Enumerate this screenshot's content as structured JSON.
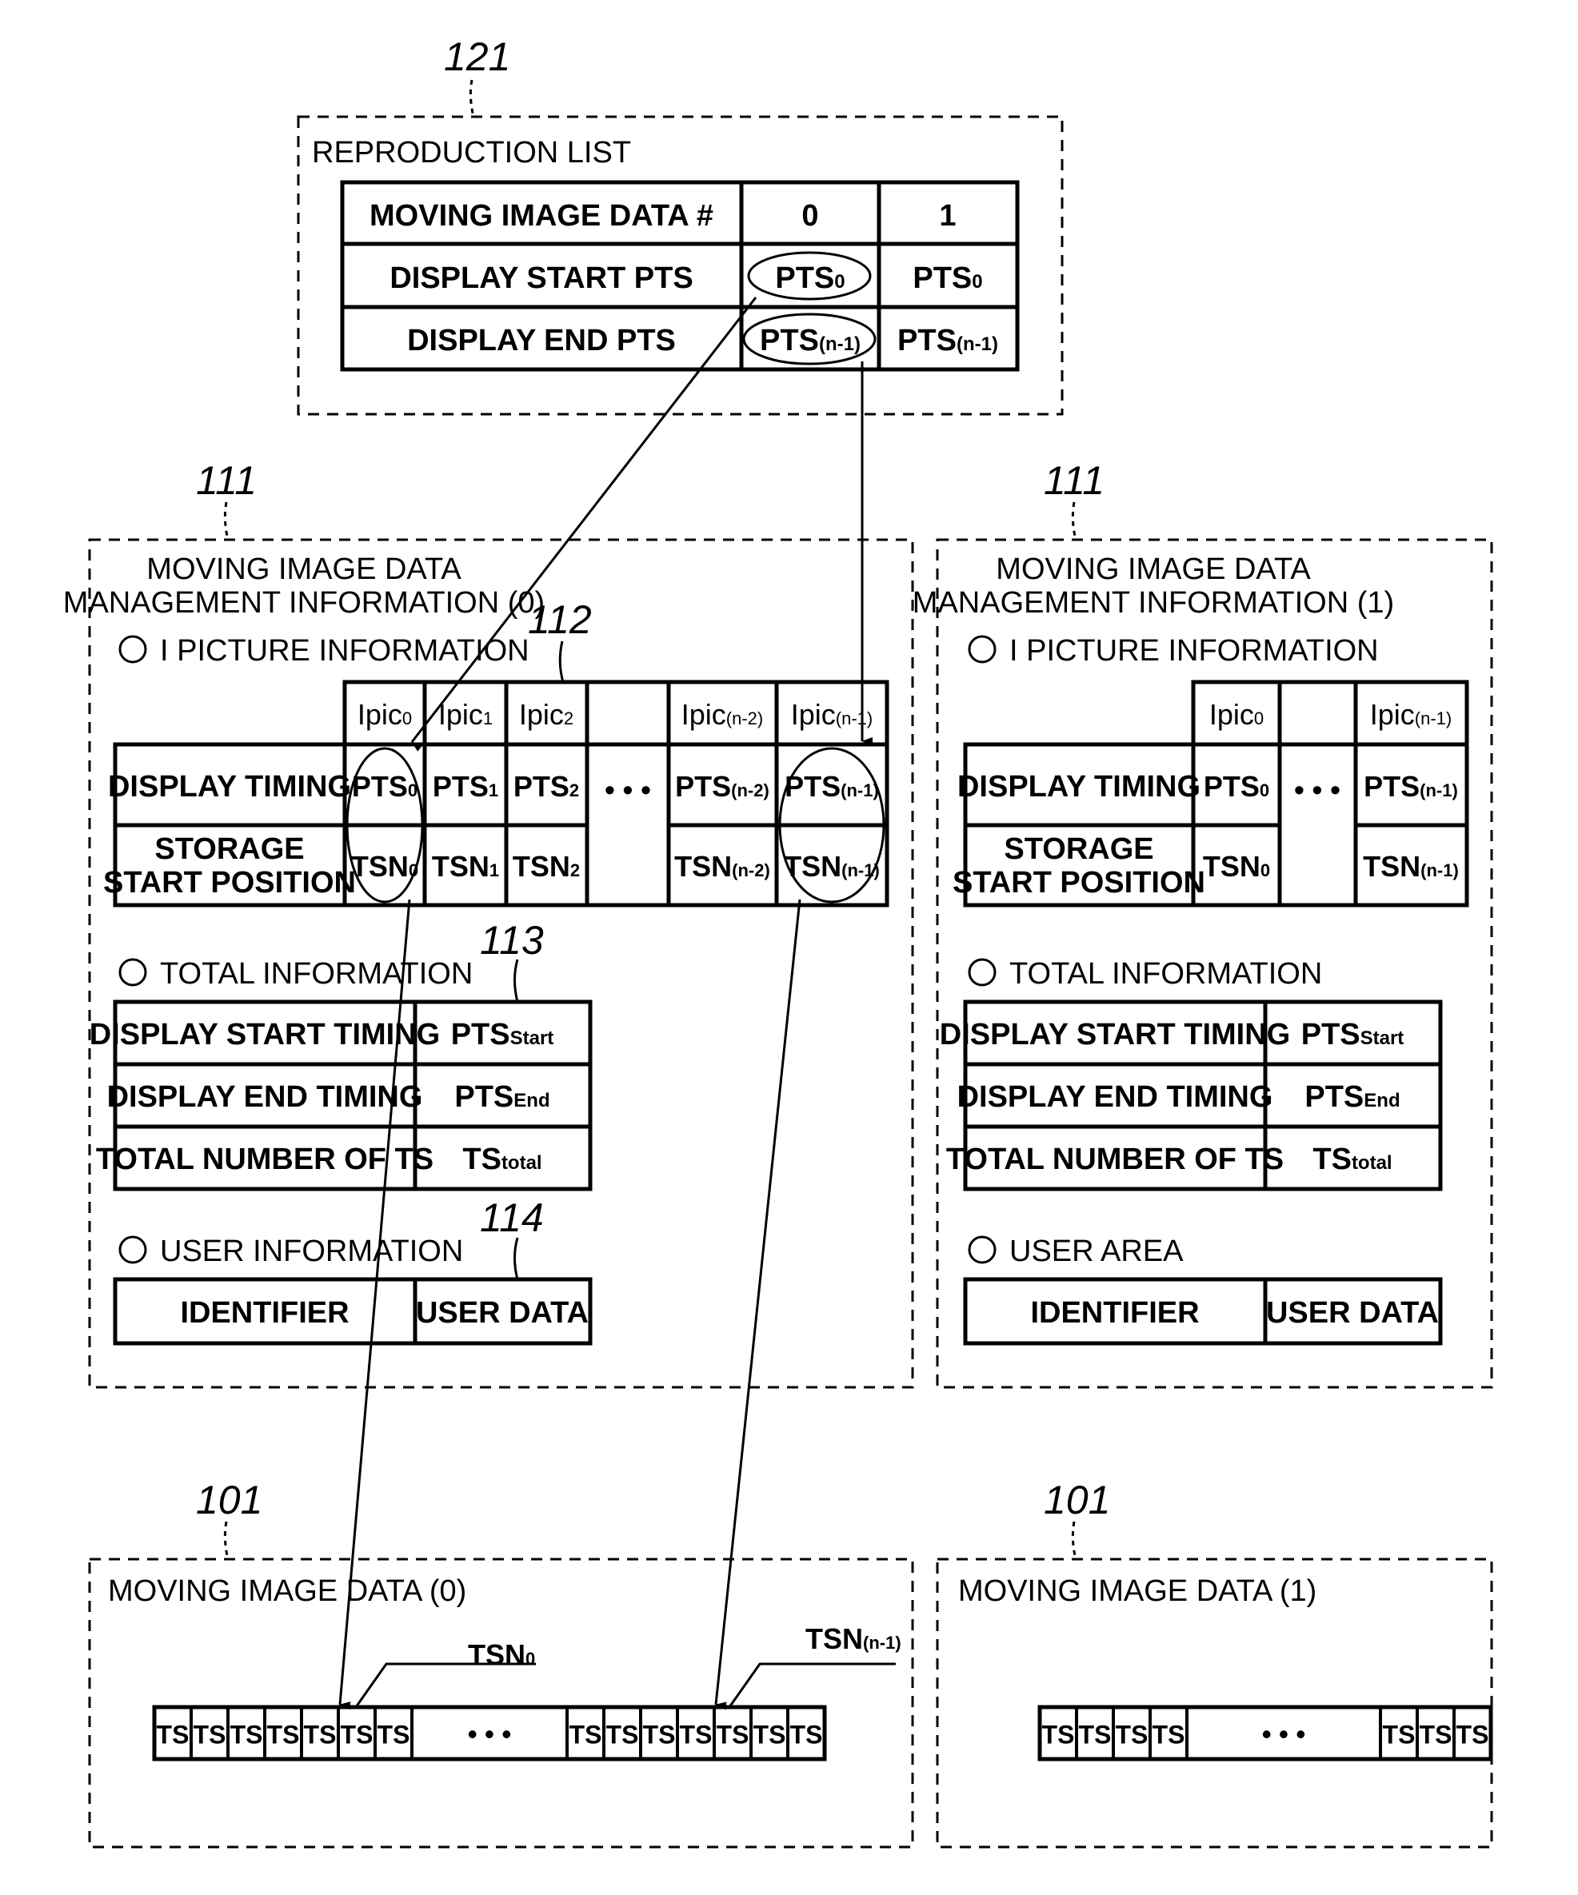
{
  "refs": {
    "reproduction_list": "121",
    "management_info": "111",
    "i_picture_table": "112",
    "total_info_table": "113",
    "user_info_table": "114",
    "moving_image_data": "101"
  },
  "reproduction_list": {
    "title": "REPRODUCTION LIST",
    "rows": [
      {
        "label": "MOVING IMAGE DATA #",
        "cells": [
          {
            "main": "0",
            "sub": ""
          },
          {
            "main": "1",
            "sub": ""
          }
        ]
      },
      {
        "label": "DISPLAY START PTS",
        "cells": [
          {
            "main": "PTS",
            "sub": "0"
          },
          {
            "main": "PTS",
            "sub": "0"
          }
        ]
      },
      {
        "label": "DISPLAY END PTS",
        "cells": [
          {
            "main": "PTS",
            "sub": "(n-1)"
          },
          {
            "main": "PTS",
            "sub": "(n-1)"
          }
        ]
      }
    ]
  },
  "management": [
    {
      "title_line1": "MOVING IMAGE DATA",
      "title_line2": "MANAGEMENT INFORMATION (0)",
      "i_picture": {
        "heading": "I PICTURE INFORMATION",
        "row_labels": [
          "DISPLAY TIMING",
          "STORAGE",
          "START POSITION"
        ],
        "columns": [
          {
            "ipic": "Ipic",
            "ipic_sub": "0",
            "pts": "PTS",
            "pts_sub": "0",
            "tsn": "TSN",
            "tsn_sub": "0"
          },
          {
            "ipic": "Ipic",
            "ipic_sub": "1",
            "pts": "PTS",
            "pts_sub": "1",
            "tsn": "TSN",
            "tsn_sub": "1"
          },
          {
            "ipic": "Ipic",
            "ipic_sub": "2",
            "pts": "PTS",
            "pts_sub": "2",
            "tsn": "TSN",
            "tsn_sub": "2"
          },
          {
            "ellipsis": "• • •"
          },
          {
            "ipic": "Ipic",
            "ipic_sub": "(n-2)",
            "pts": "PTS",
            "pts_sub": "(n-2)",
            "tsn": "TSN",
            "tsn_sub": "(n-2)"
          },
          {
            "ipic": "Ipic",
            "ipic_sub": "(n-1)",
            "pts": "PTS",
            "pts_sub": "(n-1)",
            "tsn": "TSN",
            "tsn_sub": "(n-1)"
          }
        ]
      },
      "total": {
        "heading": "TOTAL INFORMATION",
        "rows": [
          {
            "label": "DISPLAY START TIMING",
            "main": "PTS",
            "sub": "Start"
          },
          {
            "label": "DISPLAY END TIMING",
            "main": "PTS",
            "sub": "End"
          },
          {
            "label": "TOTAL NUMBER OF TS",
            "main": "TS",
            "sub": "total"
          }
        ]
      },
      "user": {
        "heading": "USER INFORMATION",
        "cells": [
          "IDENTIFIER",
          "USER DATA"
        ]
      }
    },
    {
      "title_line1": "MOVING IMAGE DATA",
      "title_line2": "MANAGEMENT INFORMATION (1)",
      "i_picture": {
        "heading": "I PICTURE INFORMATION",
        "row_labels": [
          "DISPLAY TIMING",
          "STORAGE",
          "START POSITION"
        ],
        "columns": [
          {
            "ipic": "Ipic",
            "ipic_sub": "0",
            "pts": "PTS",
            "pts_sub": "0",
            "tsn": "TSN",
            "tsn_sub": "0"
          },
          {
            "ellipsis": "• • •"
          },
          {
            "ipic": "Ipic",
            "ipic_sub": "(n-1)",
            "pts": "PTS",
            "pts_sub": "(n-1)",
            "tsn": "TSN",
            "tsn_sub": "(n-1)"
          }
        ]
      },
      "total": {
        "heading": "TOTAL INFORMATION",
        "rows": [
          {
            "label": "DISPLAY START TIMING",
            "main": "PTS",
            "sub": "Start"
          },
          {
            "label": "DISPLAY END TIMING",
            "main": "PTS",
            "sub": "End"
          },
          {
            "label": "TOTAL NUMBER OF TS",
            "main": "TS",
            "sub": "total"
          }
        ]
      },
      "user": {
        "heading": "USER AREA",
        "cells": [
          "IDENTIFIER",
          "USER DATA"
        ]
      }
    }
  ],
  "moving_image_data": [
    {
      "title": "MOVING IMAGE DATA (0)",
      "packet_label": "TS",
      "ellipsis": "• • •",
      "callouts": [
        {
          "main": "TSN",
          "sub": "0"
        },
        {
          "main": "TSN",
          "sub": "(n-1)"
        }
      ]
    },
    {
      "title": "MOVING IMAGE DATA (1)",
      "packet_label": "TS",
      "ellipsis": "• • •"
    }
  ]
}
